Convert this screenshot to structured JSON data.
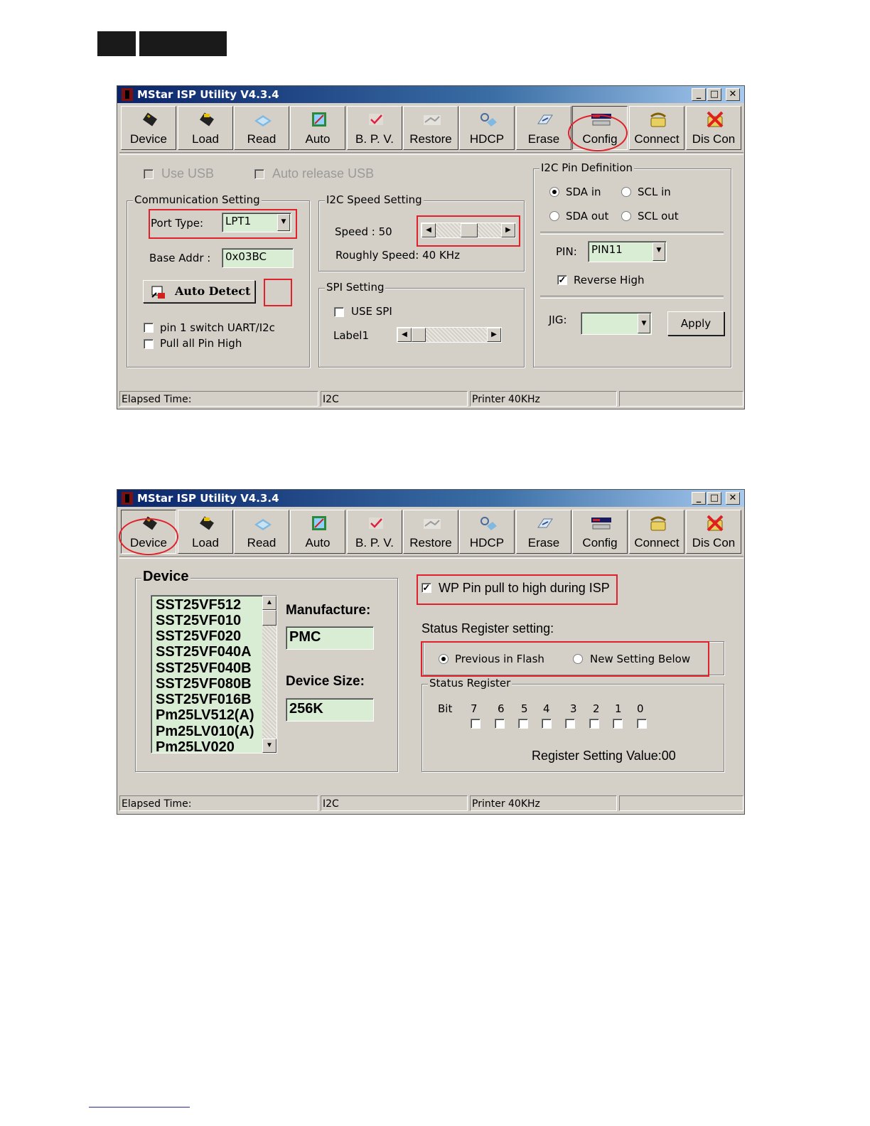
{
  "app": {
    "title": "MStar ISP Utility V4.3.4"
  },
  "window_buttons": {
    "minimize": "_",
    "maximize": "□",
    "close": "✕"
  },
  "toolbar": [
    {
      "label": "Device",
      "icon": "chip-icon"
    },
    {
      "label": "Load",
      "icon": "chip-load-icon"
    },
    {
      "label": "Read",
      "icon": "read-icon"
    },
    {
      "label": "Auto",
      "icon": "auto-icon"
    },
    {
      "label": "B. P. V.",
      "icon": "check-icon"
    },
    {
      "label": "Restore",
      "icon": "restore-icon"
    },
    {
      "label": "HDCP",
      "icon": "hdcp-icon"
    },
    {
      "label": "Erase",
      "icon": "erase-icon"
    },
    {
      "label": "Config",
      "icon": "config-icon"
    },
    {
      "label": "Connect",
      "icon": "phone-icon"
    },
    {
      "label": "Dis Con",
      "icon": "disconnect-icon"
    }
  ],
  "config": {
    "use_usb": "Use USB",
    "auto_release_usb": "Auto release USB",
    "comm": {
      "title": "Communication Setting",
      "port_type_label": "Port Type:",
      "port_type_value": "LPT1",
      "base_addr_label": "Base Addr :",
      "base_addr_value": "0x03BC",
      "auto_detect": "Auto Detect",
      "pin1_switch": "pin 1 switch UART/I2c",
      "pull_all_pin_high": "Pull all Pin High"
    },
    "i2c_speed": {
      "title": "I2C Speed Setting",
      "speed_label": "Speed :  50",
      "speed_value": 50,
      "roughly_speed": "Roughly Speed: 40 KHz"
    },
    "spi": {
      "title": "SPI Setting",
      "use_spi": "USE SPI",
      "label1": "Label1"
    },
    "i2c_pin": {
      "title": "I2C Pin Definition",
      "sda_in": "SDA in",
      "scl_in": "SCL in",
      "sda_out": "SDA out",
      "scl_out": "SCL out",
      "pin_label": "PIN:",
      "pin_value": "PIN11",
      "reverse_high": "Reverse High",
      "jig_label": "JIG:",
      "jig_value": "",
      "apply": "Apply"
    }
  },
  "statusbar": {
    "elapsed": "Elapsed Time:",
    "bus": "I2C",
    "printer": "Printer  40KHz",
    "extra": ""
  },
  "device_panel": {
    "title": "Device",
    "devices": [
      "SST25VF512",
      "SST25VF010",
      "SST25VF020",
      "SST25VF040A",
      "SST25VF040B",
      "SST25VF080B",
      "SST25VF016B",
      "Pm25LV512(A)",
      "Pm25LV010(A)",
      "Pm25LV020"
    ],
    "manufacture_label": "Manufacture:",
    "manufacture_value": "PMC",
    "device_size_label": "Device Size:",
    "device_size_value": "256K",
    "wp_pin": "WP Pin pull to high during ISP",
    "status_reg_setting": "Status Register setting:",
    "previous_in_flash": "Previous in Flash",
    "new_setting_below": "New Setting Below",
    "status_register_title": "Status Register",
    "bit_label": "Bit",
    "bits": [
      "7",
      "6",
      "5",
      "4",
      "3",
      "2",
      "1",
      "0"
    ],
    "register_value": "Register Setting Value:00"
  },
  "colors": {
    "accent_red": "#e0202a",
    "field_green": "#d9ecd4",
    "title_blue": "#0a246a"
  }
}
